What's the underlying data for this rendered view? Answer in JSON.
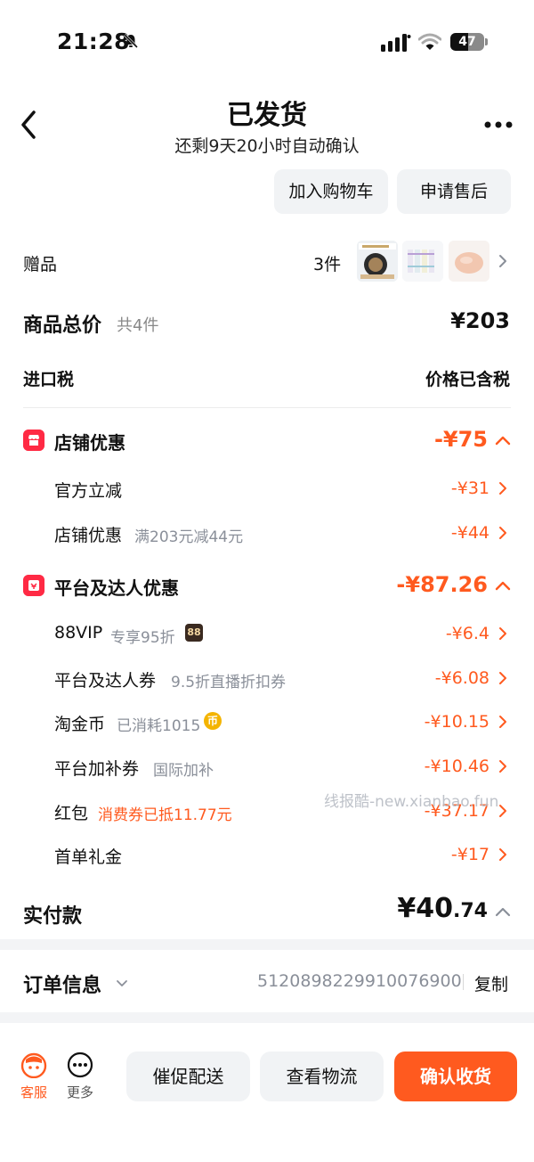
{
  "status_bar": {
    "time": "21:28",
    "battery": "47"
  },
  "header": {
    "title": "已发货",
    "subtitle": "还剩9天20小时自动确认",
    "add_cart_label": "加入购物车",
    "after_sale_label": "申请售后"
  },
  "gift": {
    "label": "赠品",
    "count": "3件"
  },
  "summary": {
    "total_label": "商品总价",
    "total_count": "共4件",
    "total_value": "¥203",
    "tax_label": "进口税",
    "tax_value": "价格已含税"
  },
  "shop_discount": {
    "title": "店铺优惠",
    "value": "-¥75",
    "items": [
      {
        "label": "官方立减",
        "sub": "",
        "value": "-¥31"
      },
      {
        "label": "店铺优惠",
        "sub": "满203元减44元",
        "value": "-¥44"
      }
    ]
  },
  "platform_discount": {
    "title": "平台及达人优惠",
    "value": "-¥87.26",
    "items": [
      {
        "label": "88VIP",
        "sub": "专享95折",
        "badge": "88",
        "value": "-¥6.4"
      },
      {
        "label": "平台及达人券",
        "sub": "9.5折直播折扣券",
        "value": "-¥6.08"
      },
      {
        "label": "淘金币",
        "sub": "已消耗1015",
        "coin": "币",
        "value": "-¥10.15"
      },
      {
        "label": "平台加补券",
        "sub": "国际加补",
        "value": "-¥10.46"
      },
      {
        "label": "红包",
        "sub": "消费券已抵11.77元",
        "value": "-¥37.17"
      },
      {
        "label": "首单礼金",
        "sub": "",
        "value": "-¥17"
      }
    ]
  },
  "watermark": "线报酷-new.xianbao.fun",
  "payment": {
    "label": "实付款",
    "value_int": "¥40",
    "value_dec": ".74"
  },
  "order": {
    "label": "订单信息",
    "number": "5120898229910076900",
    "copy_label": "复制"
  },
  "bottom_bar": {
    "service_label": "客服",
    "more_label": "更多",
    "urge_label": "催促配送",
    "logistics_label": "查看物流",
    "confirm_label": "确认收货"
  },
  "colors": {
    "accent": "#ff5a1f",
    "discount_icon": "#ff2a44"
  }
}
